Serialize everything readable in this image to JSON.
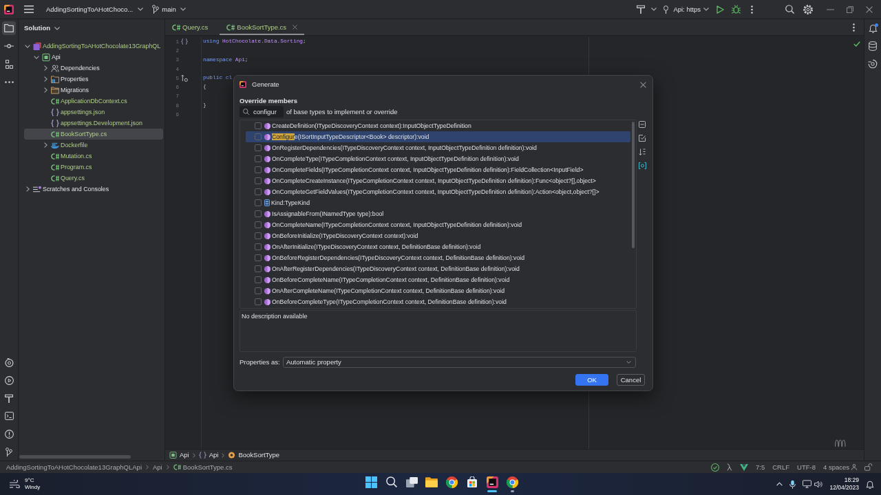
{
  "title_bar": {
    "project": "AddingSortingToAHotChoco...",
    "branch": "main",
    "run_config": "Api: https"
  },
  "left_toolbar": {
    "top": [
      {
        "kind": "project",
        "selected": true
      },
      {
        "kind": "commit",
        "selected": false
      },
      {
        "kind": "structure",
        "selected": false
      },
      {
        "kind": "more",
        "selected": false
      }
    ],
    "bottom": [
      {
        "kind": "services",
        "selected": false
      },
      {
        "kind": "run",
        "selected": false
      },
      {
        "kind": "build",
        "selected": false
      },
      {
        "kind": "terminal",
        "selected": false
      },
      {
        "kind": "problems",
        "selected": false
      },
      {
        "kind": "git",
        "selected": false
      }
    ]
  },
  "right_toolbar": [
    {
      "kind": "notifications",
      "unread": true
    },
    {
      "kind": "database",
      "unread": false
    },
    {
      "kind": "coverage",
      "unread": false
    }
  ],
  "project_panel": {
    "title": "Solution",
    "tree": [
      {
        "label": "AddingSortingToAHotChocolate13GraphQL",
        "kind": "solution",
        "expanded": true,
        "selected": false,
        "added": true,
        "children": [
          {
            "label": "Api",
            "kind": "project",
            "expanded": true,
            "selected": false,
            "added": false,
            "children": [
              {
                "label": "Dependencies",
                "kind": "dependencies",
                "expanded": false,
                "selected": false,
                "added": false
              },
              {
                "label": "Properties",
                "kind": "properties",
                "expanded": false,
                "selected": false,
                "added": false
              },
              {
                "label": "Migrations",
                "kind": "folder",
                "expanded": false,
                "selected": false,
                "added": false
              },
              {
                "label": "ApplicationDbContext.cs",
                "kind": "csharp",
                "selected": false,
                "added": true
              },
              {
                "label": "appsettings.json",
                "kind": "json",
                "selected": false,
                "added": true
              },
              {
                "label": "appsettings.Development.json",
                "kind": "json",
                "selected": false,
                "added": true
              },
              {
                "label": "BookSortType.cs",
                "kind": "csharp",
                "selected": true,
                "added": true
              },
              {
                "label": "Dockerfile",
                "kind": "docker",
                "expanded": false,
                "selected": false,
                "added": true
              },
              {
                "label": "Mutation.cs",
                "kind": "csharp",
                "selected": false,
                "added": true
              },
              {
                "label": "Program.cs",
                "kind": "csharp",
                "selected": false,
                "added": true
              },
              {
                "label": "Query.cs",
                "kind": "csharp",
                "selected": false,
                "added": true
              }
            ]
          }
        ]
      },
      {
        "label": "Scratches and Consoles",
        "kind": "scratches",
        "expanded": false,
        "selected": false,
        "added": false
      }
    ]
  },
  "editor": {
    "tabs": [
      {
        "label": "Query.cs",
        "kind": "csharp",
        "selected": false
      },
      {
        "label": "BookSortType.cs",
        "kind": "csharp",
        "selected": true
      }
    ],
    "lines": [
      {
        "number": "1",
        "gutter": {
          "kind": "namespace"
        },
        "tokens": [
          {
            "text": "using ",
            "kind": "keyword"
          },
          {
            "text": "HotChocolate.Data.Sorting",
            "kind": "namespace"
          },
          {
            "text": ";",
            "kind": "plain"
          }
        ]
      },
      {
        "number": "2"
      },
      {
        "number": "3",
        "tokens": [
          {
            "text": "namespace ",
            "kind": "keyword"
          },
          {
            "text": "Api",
            "kind": "namespace"
          },
          {
            "text": ";",
            "kind": "plain"
          }
        ]
      },
      {
        "number": "4"
      },
      {
        "number": "5",
        "gutter": {
          "kind": "override"
        },
        "tokens": [
          {
            "text": "public cl",
            "kind": "keyword"
          }
        ]
      },
      {
        "number": "6",
        "tokens": [
          {
            "text": "{",
            "kind": "plain"
          }
        ]
      },
      {
        "number": "7"
      },
      {
        "number": "8",
        "tokens": [
          {
            "text": "}",
            "kind": "plain"
          }
        ]
      },
      {
        "number": "9"
      }
    ],
    "breadcrumbs": [
      {
        "label": "Api",
        "kind": "project"
      },
      {
        "label": "Api",
        "kind": "namespace"
      },
      {
        "label": "BookSortType",
        "kind": "class"
      }
    ]
  },
  "dialog": {
    "title": "Generate",
    "heading": "Override members",
    "search": "configur",
    "hint": "of base types to implement or override",
    "members": [
      {
        "kind": "method",
        "label": "CreateDefinition(ITypeDiscoveryContext context):InputObjectTypeDefinition",
        "checked": false,
        "selected": false
      },
      {
        "kind": "method",
        "match": "Configur",
        "label": "e(ISortInputTypeDescriptor<Book> descriptor):void",
        "checked": false,
        "selected": true
      },
      {
        "kind": "method",
        "label": "OnRegisterDependencies(ITypeDiscoveryContext context, InputObjectTypeDefinition definition):void",
        "checked": false,
        "selected": false
      },
      {
        "kind": "method",
        "label": "OnCompleteType(ITypeCompletionContext context, InputObjectTypeDefinition definition):void",
        "checked": false,
        "selected": false
      },
      {
        "kind": "method",
        "label": "OnCompleteFields(ITypeCompletionContext context, InputObjectTypeDefinition definition):FieldCollection<InputField>",
        "checked": false,
        "selected": false
      },
      {
        "kind": "method",
        "label": "OnCompleteCreateInstance(ITypeCompletionContext context, InputObjectTypeDefinition definition):Func<object?[],object>",
        "checked": false,
        "selected": false
      },
      {
        "kind": "method",
        "label": "OnCompleteGetFieldValues(ITypeCompletionContext context, InputObjectTypeDefinition definition):Action<object,object?[]>",
        "checked": false,
        "selected": false
      },
      {
        "kind": "property",
        "label": "Kind:TypeKind",
        "checked": false,
        "selected": false
      },
      {
        "kind": "method",
        "label": "IsAssignableFrom(INamedType type):bool",
        "checked": false,
        "selected": false
      },
      {
        "kind": "method",
        "label": "OnCompleteName(ITypeCompletionContext context, InputObjectTypeDefinition definition):void",
        "checked": false,
        "selected": false
      },
      {
        "kind": "method",
        "label": "OnBeforeInitialize(ITypeDiscoveryContext context):void",
        "checked": false,
        "selected": false
      },
      {
        "kind": "method",
        "label": "OnAfterInitialize(ITypeDiscoveryContext context, DefinitionBase definition):void",
        "checked": false,
        "selected": false
      },
      {
        "kind": "method",
        "label": "OnBeforeRegisterDependencies(ITypeDiscoveryContext context, DefinitionBase definition):void",
        "checked": false,
        "selected": false
      },
      {
        "kind": "method",
        "label": "OnAfterRegisterDependencies(ITypeDiscoveryContext context, DefinitionBase definition):void",
        "checked": false,
        "selected": false
      },
      {
        "kind": "method",
        "label": "OnBeforeCompleteName(ITypeCompletionContext context, DefinitionBase definition):void",
        "checked": false,
        "selected": false
      },
      {
        "kind": "method",
        "label": "OnAfterCompleteName(ITypeCompletionContext context, DefinitionBase definition):void",
        "checked": false,
        "selected": false
      },
      {
        "kind": "method",
        "label": "OnBeforeCompleteType(ITypeCompletionContext context, DefinitionBase definition):void",
        "checked": false,
        "selected": false
      }
    ],
    "tools": [
      {
        "kind": "collapse",
        "on": false
      },
      {
        "kind": "select-all",
        "on": false
      },
      {
        "kind": "sort",
        "on": false
      },
      {
        "kind": "fields",
        "on": true
      }
    ],
    "description": "No description available",
    "properties_label": "Properties as:",
    "properties_value": "Automatic property",
    "buttons": [
      {
        "label": "OK",
        "kind": "primary"
      },
      {
        "label": "Cancel",
        "kind": "secondary"
      }
    ]
  },
  "status_bar": {
    "path": [
      {
        "label": "AddingSortingToAHotChocolate13GraphQLApi",
        "kind": "plain"
      },
      {
        "label": "Api",
        "kind": "plain"
      },
      {
        "label": "BookSortType.cs",
        "kind": "csharp"
      }
    ],
    "position": "7:5",
    "line_ending": "CRLF",
    "encoding": "UTF-8",
    "indent": "4 spaces"
  },
  "taskbar": {
    "weather": {
      "temperature": "9°C",
      "condition": "Windy"
    },
    "apps": [
      {
        "kind": "start",
        "running": false,
        "focused": false
      },
      {
        "kind": "search",
        "running": false,
        "focused": false
      },
      {
        "kind": "task-view",
        "running": false,
        "focused": false
      },
      {
        "kind": "explorer",
        "running": false,
        "focused": false
      },
      {
        "kind": "browser",
        "running": false,
        "focused": false
      },
      {
        "kind": "store",
        "running": false,
        "focused": false
      },
      {
        "kind": "ide",
        "running": true,
        "focused": true
      },
      {
        "kind": "browser",
        "running": true,
        "focused": false
      }
    ],
    "time": "18:29",
    "date": "12/04/2023"
  }
}
